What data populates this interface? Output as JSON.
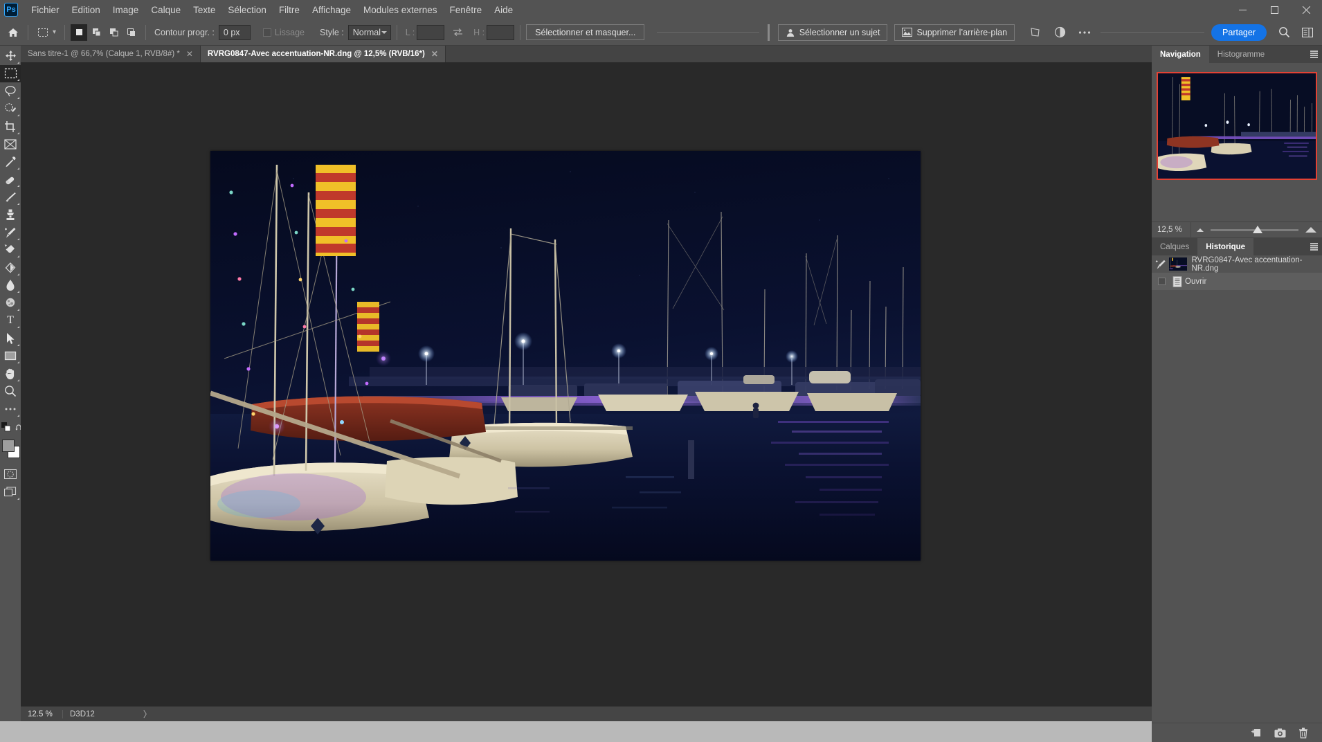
{
  "app": {
    "logo": "Ps",
    "title": "Adobe Photoshop"
  },
  "titlebar": {
    "menus": [
      "Fichier",
      "Edition",
      "Image",
      "Calque",
      "Texte",
      "Sélection",
      "Filtre",
      "Affichage",
      "Modules externes",
      "Fenêtre",
      "Aide"
    ],
    "window_controls": [
      {
        "name": "minimize",
        "glyph": "—"
      },
      {
        "name": "maximize",
        "glyph": "☐"
      },
      {
        "name": "close",
        "glyph": "✕"
      }
    ]
  },
  "options_bar": {
    "home_icon": "home-icon",
    "tool_preset_icon": "marquee-tool-icon",
    "tool_preset_caret": "⌄",
    "selection_modes": [
      "new-selection",
      "add-to-selection",
      "subtract-from-selection",
      "intersect-selection"
    ],
    "feather_label": "Contour progr. :",
    "feather_value": "0 px",
    "antialias_label": "Lissage",
    "style_label": "Style :",
    "style_value": "Normal",
    "width_label": "L :",
    "width_value": "",
    "swap_icon": "swap-dimensions-icon",
    "height_label": "H :",
    "height_value": "",
    "select_and_mask": "Sélectionner et masquer...",
    "select_subject": "Sélectionner un sujet",
    "remove_background": "Supprimer l’arrière-plan",
    "transform_icon": "perspective-warp-icon",
    "adjust_icon": "contrast-adjust-icon",
    "more_icon": "more-options-icon",
    "share_label": "Partager",
    "search_icon": "search-icon",
    "workspace_icon": "workspace-switcher-icon"
  },
  "tabs": [
    {
      "label": "Sans titre-1 @ 66,7% (Calque 1, RVB/8#) *",
      "active": false,
      "close": "✕"
    },
    {
      "label": "RVRG0847-Avec accentuation-NR.dng @ 12,5% (RVB/16*)",
      "active": true,
      "close": "✕"
    }
  ],
  "toolbar": {
    "tools": [
      {
        "name": "move-tool",
        "glyph": "✥",
        "active": false,
        "corner": true
      },
      {
        "name": "rectangular-marquee-tool",
        "glyph": "⬚",
        "active": true,
        "corner": true
      },
      {
        "name": "lasso-tool",
        "glyph": "❀",
        "active": false,
        "corner": true
      },
      {
        "name": "object-selection-tool",
        "glyph": "◌",
        "active": false,
        "corner": true
      },
      {
        "name": "crop-tool",
        "glyph": "⌙",
        "active": false,
        "corner": true
      },
      {
        "name": "frame-tool",
        "glyph": "⌧",
        "active": false,
        "corner": false
      },
      {
        "name": "eyedropper-tool",
        "glyph": "✐",
        "active": false,
        "corner": true
      },
      {
        "name": "spot-healing-brush-tool",
        "glyph": "❁",
        "active": false,
        "corner": true
      },
      {
        "name": "brush-tool",
        "glyph": "✎",
        "active": false,
        "corner": true
      },
      {
        "name": "clone-stamp-tool",
        "glyph": "⚑",
        "active": false,
        "corner": true
      },
      {
        "name": "history-brush-tool",
        "glyph": "✒",
        "active": false,
        "corner": true
      },
      {
        "name": "eraser-tool",
        "glyph": "◪",
        "active": false,
        "corner": true
      },
      {
        "name": "gradient-tool",
        "glyph": "◩",
        "active": false,
        "corner": true
      },
      {
        "name": "blur-tool",
        "glyph": "●",
        "active": false,
        "corner": true
      },
      {
        "name": "dodge-tool",
        "glyph": "◔",
        "active": false,
        "corner": true
      },
      {
        "name": "type-tool",
        "glyph": "T",
        "active": false,
        "corner": true
      },
      {
        "name": "path-selection-tool",
        "glyph": "➤",
        "active": false,
        "corner": true
      },
      {
        "name": "rectangle-tool",
        "glyph": "▭",
        "active": false,
        "corner": true
      },
      {
        "name": "hand-tool",
        "glyph": "✋",
        "active": false,
        "corner": true
      },
      {
        "name": "zoom-tool",
        "glyph": "⚲",
        "active": false,
        "corner": false
      },
      {
        "name": "edit-toolbar-tool",
        "glyph": "⋯",
        "active": false,
        "corner": false
      }
    ],
    "default_colors_icon": "default-colors-icon",
    "swap_colors_icon": "swap-colors-icon",
    "foreground_color": "#9e9e9e",
    "background_color": "#ffffff",
    "quick_mask_icon": "quick-mask-icon",
    "screen_mode_icon": "screen-mode-icon"
  },
  "status_bar": {
    "zoom": "12.5 %",
    "info": "D3D12",
    "arrow": "〉"
  },
  "navigator": {
    "tabs": [
      {
        "label": "Navigation",
        "active": true
      },
      {
        "label": "Histogramme",
        "active": false
      }
    ],
    "menu_icon": "panel-menu-icon",
    "view_box_color": "#e34234",
    "zoom_value": "12,5 %",
    "zoom_out_icon": "zoom-out-icon",
    "zoom_in_icon": "zoom-in-icon",
    "slider_position_pct": 48
  },
  "history": {
    "tabs": [
      {
        "label": "Calques",
        "active": false
      },
      {
        "label": "Historique",
        "active": true
      }
    ],
    "menu_icon": "panel-menu-icon",
    "entries": [
      {
        "type": "snapshot",
        "label": "RVRG0847-Avec accentuation-NR.dng",
        "selected": false,
        "icon": "history-brush-icon"
      },
      {
        "type": "state",
        "label": "Ouvrir",
        "selected": true,
        "icon": "document-icon"
      }
    ],
    "footer_icons": [
      {
        "name": "new-document-from-state-icon",
        "glyph": "❐"
      },
      {
        "name": "snapshot-camera-icon",
        "glyph": "▣"
      },
      {
        "name": "delete-trash-icon",
        "glyph": "Ὕ1"
      }
    ]
  },
  "document": {
    "name": "RVRG0847-Avec accentuation-NR.dng",
    "zoom": "12,5%",
    "mode": "RVB/16*",
    "scene": "night harbour with moored sailboats, Catalan flag, purple and yellow dock lights reflected in dark water"
  }
}
